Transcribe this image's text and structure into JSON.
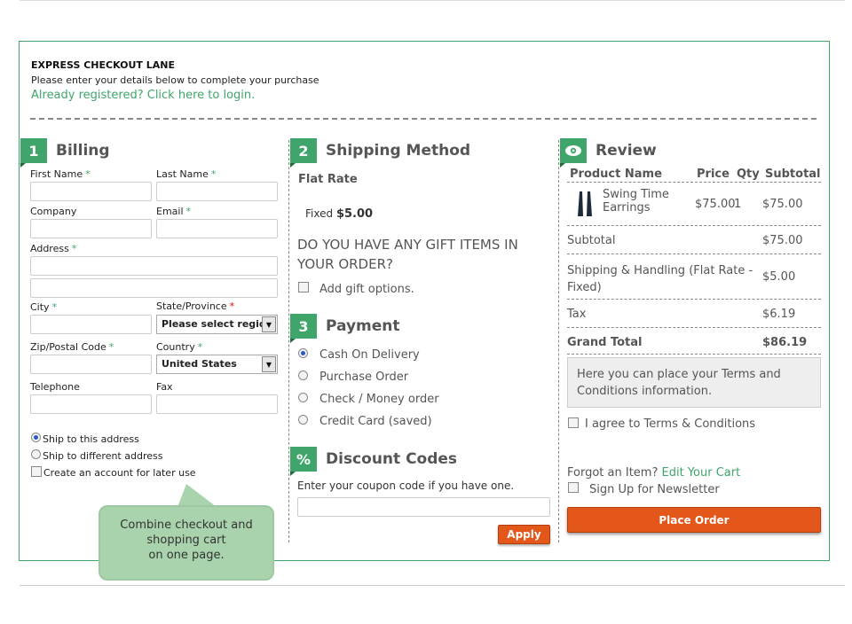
{
  "header": {
    "title": "EXPRESS CHECKOUT LANE",
    "subtitle": "Please enter your details below to complete your purchase",
    "login_link": "Already registered? Click here to login."
  },
  "billing": {
    "number": "1",
    "title": "Billing",
    "first_name": "First Name",
    "last_name": "Last Name",
    "company": "Company",
    "email": "Email",
    "address": "Address",
    "city": "City",
    "state": "State/Province",
    "state_value": "Please select region, state or province",
    "zip": "Zip/Postal Code",
    "country": "Country",
    "country_value": "United States",
    "telephone": "Telephone",
    "fax": "Fax",
    "required_mark": "*",
    "ship_same": "Ship to this address",
    "ship_diff": "Ship to different address",
    "create_account": "Create an account for later use"
  },
  "callout": {
    "line1": "Combine checkout and",
    "line2": "shopping cart",
    "line3": "on one  page."
  },
  "shipping": {
    "number": "2",
    "title": "Shipping Method",
    "method": "Flat Rate",
    "fixed_label": "Fixed",
    "fixed_price": "$5.00",
    "gift_question_1": "DO YOU HAVE ANY GIFT ITEMS IN",
    "gift_question_2": "YOUR ORDER?",
    "gift_option": "Add gift options."
  },
  "payment": {
    "number": "3",
    "title": "Payment",
    "options": [
      "Cash On Delivery",
      "Purchase Order",
      "Check / Money order",
      "Credit Card (saved)"
    ],
    "selected": 0
  },
  "discount": {
    "badge": "%",
    "title": "Discount Codes",
    "prompt": "Enter your coupon code if you have one.",
    "apply": "Apply"
  },
  "review": {
    "title": "Review",
    "icon": "eye-icon",
    "columns": [
      "Product Name",
      "Price",
      "Qty",
      "Subtotal"
    ],
    "item": {
      "name_1": "Swing Time",
      "name_2": "Earrings",
      "price": "$75.00",
      "qty": "1",
      "subtotal": "$75.00"
    },
    "subtotal_label": "Subtotal",
    "subtotal": "$75.00",
    "shipping_label_1": "Shipping & Handling (Flat Rate -",
    "shipping_label_2": "Fixed)",
    "shipping": "$5.00",
    "tax_label": "Tax",
    "tax": "$6.19",
    "grand_label": "Grand Total",
    "grand": "$86.19",
    "terms_text": "Here you can place your Terms and Conditions information.",
    "agree": "I agree to Terms & Conditions",
    "forgot": "Forgot an Item?",
    "edit_cart": "Edit Your Cart",
    "newsletter": "Sign Up for Newsletter",
    "place_order": "Place Order"
  },
  "colors": {
    "accent": "#3fa56a",
    "button": "#e4571b",
    "callout": "#a9d3ad"
  }
}
